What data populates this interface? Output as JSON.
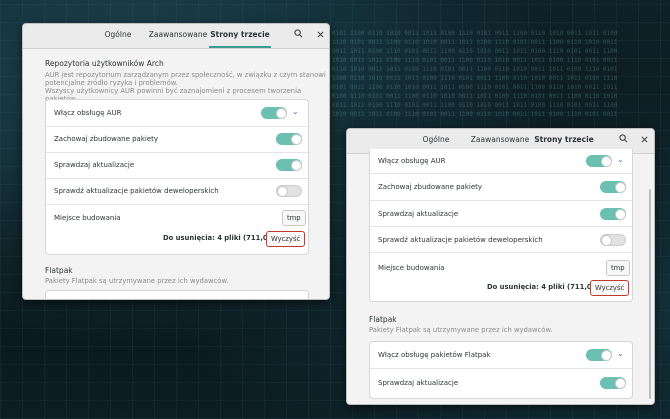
{
  "tabs": {
    "general": "Ogólne",
    "advanced": "Zaawansowane",
    "third_party": "Strony trzecie"
  },
  "aur": {
    "title": "Repozytoria użytkowników Arch",
    "desc1": "AUR jest repozytorium zarządzanym przez społeczność, w związku z czym stanowi",
    "desc2": "potencjalne źródło ryzyka i problemów.",
    "desc3": "Wszyscy użytkownicy AUR powinni być zaznajomieni z procesem tworzenia pakietów.",
    "enable": "Włącz obsługę AUR",
    "keep": "Zachowaj zbudowane pakiety",
    "check": "Sprawdzaj aktualizacje",
    "check_dev": "Sprawdź aktualizacje pakietów deweloperskich",
    "build_dir": "Miejsce budowania",
    "build_dir_value": "tmp",
    "to_delete": "Do usunięcia:  4 pliki  (711,0 MB)",
    "clear": "Wyczyść"
  },
  "flatpak": {
    "title": "Flatpak",
    "desc": "Pakiety Flatpak są utrzymywane przez ich wydawców.",
    "enable": "Włącz obsługę pakietów Flatpak",
    "check": "Sprawdzaj aktualizacje"
  },
  "colors": {
    "accent": "#6cc0b2",
    "link": "#3a79c8",
    "danger": "#c0392b"
  }
}
